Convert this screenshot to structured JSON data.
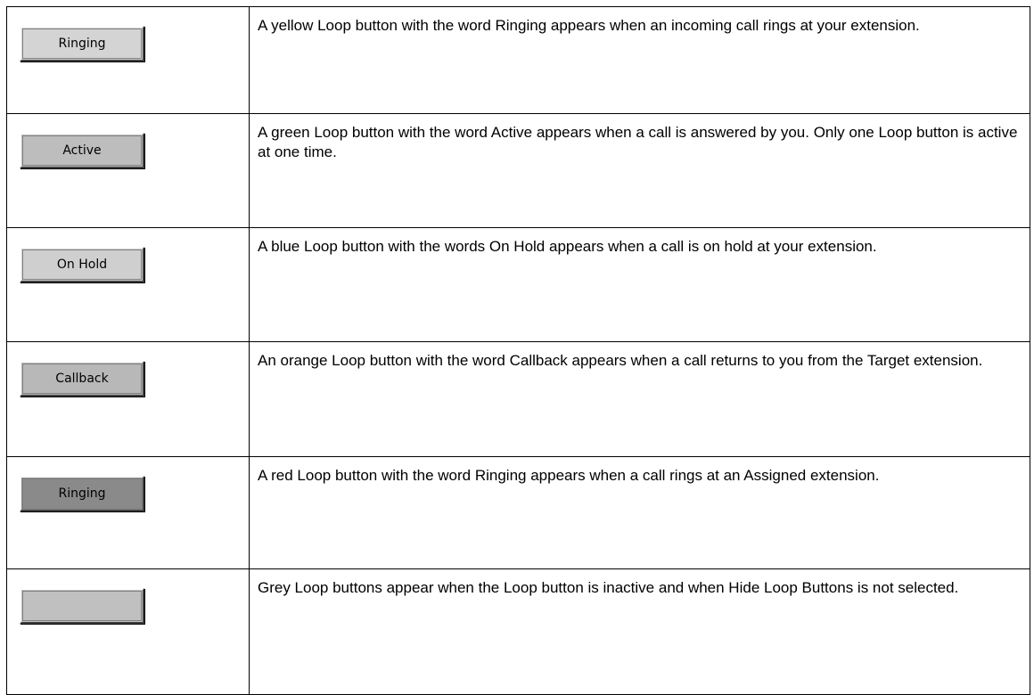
{
  "rows": [
    {
      "button_label": "Ringing",
      "button_color": "#d4d4d4",
      "description": "A yellow Loop button with the word Ringing appears when an incoming call rings at your extension."
    },
    {
      "button_label": "Active",
      "button_color": "#bdbdbd",
      "description": "A green Loop button with the word Active appears when a call is answered by you. Only one Loop button is active at one time."
    },
    {
      "button_label": "On Hold",
      "button_color": "#cfcfcf",
      "description": "A blue Loop button with the words On Hold appears when a call is on hold at your extension."
    },
    {
      "button_label": "Callback",
      "button_color": "#b8b8b8",
      "description": "An orange Loop button with the word Callback appears when a call returns to you from the Target extension."
    },
    {
      "button_label": "Ringing",
      "button_color": "#8a8a8a",
      "description": "A red Loop button with the word Ringing appears when a call rings at an Assigned extension."
    },
    {
      "button_label": "",
      "button_color": "#c0c0c0",
      "description": "Grey Loop buttons appear when the Loop button is inactive and when Hide Loop Buttons is not selected."
    }
  ]
}
